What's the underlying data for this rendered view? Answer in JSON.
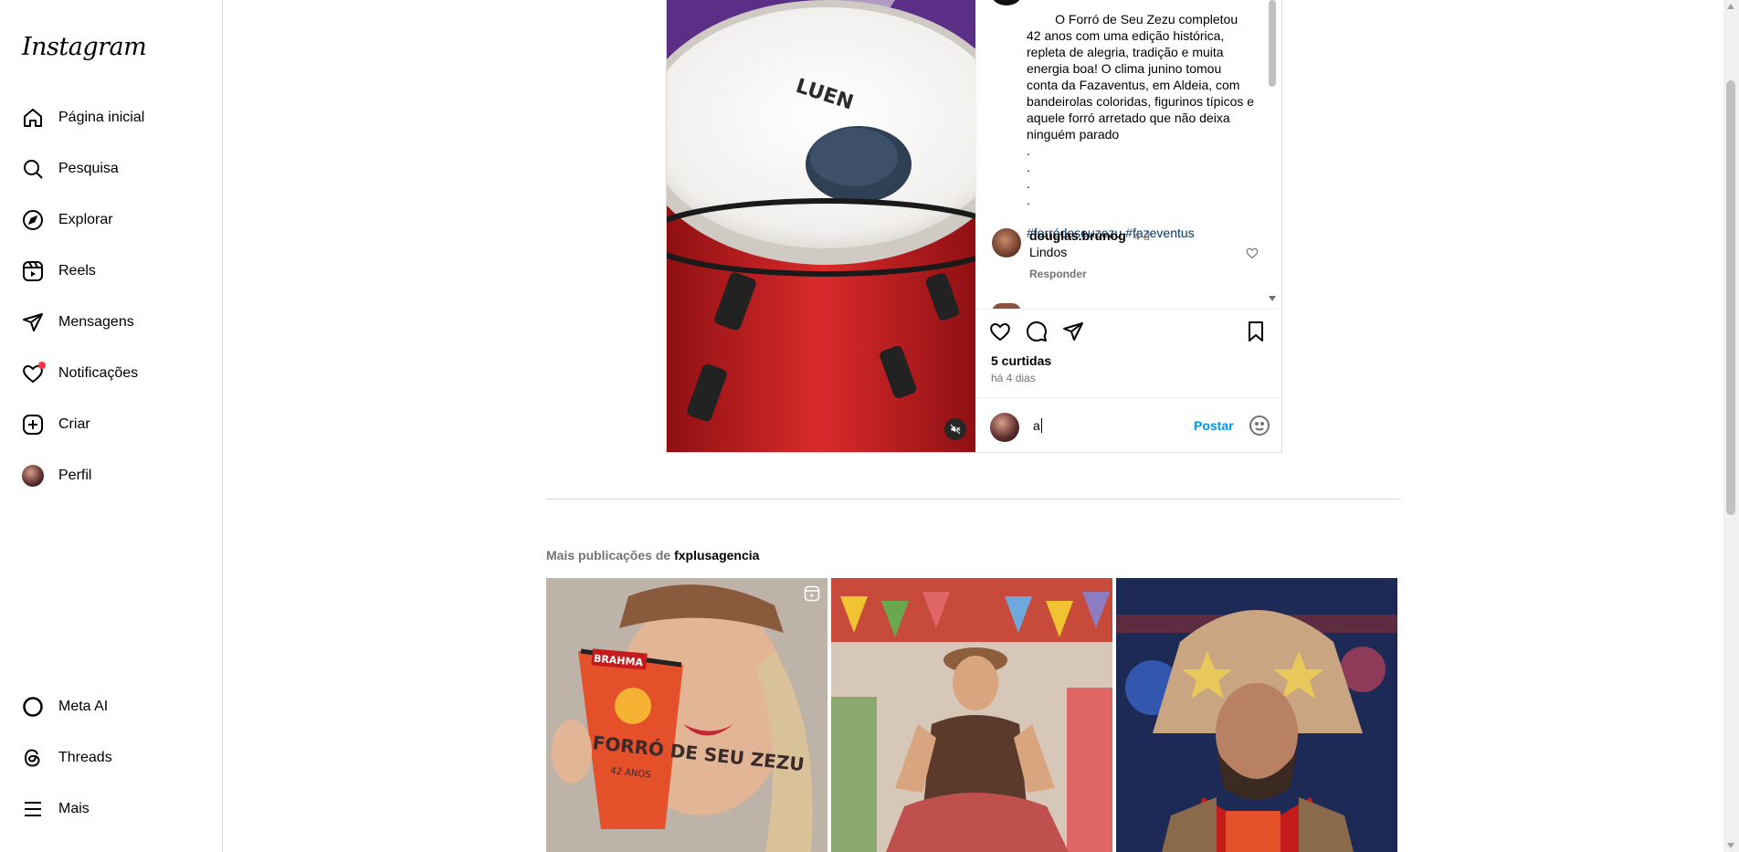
{
  "app": {
    "logo": "Instagram"
  },
  "nav": {
    "items": [
      {
        "key": "home",
        "label": "Página inicial"
      },
      {
        "key": "search",
        "label": "Pesquisa"
      },
      {
        "key": "explore",
        "label": "Explorar"
      },
      {
        "key": "reels",
        "label": "Reels"
      },
      {
        "key": "messages",
        "label": "Mensagens"
      },
      {
        "key": "notifications",
        "label": "Notificações"
      },
      {
        "key": "create",
        "label": "Criar"
      },
      {
        "key": "profile",
        "label": "Perfil"
      }
    ],
    "bottom": [
      {
        "key": "meta-ai",
        "label": "Meta AI"
      },
      {
        "key": "threads",
        "label": "Threads"
      },
      {
        "key": "more",
        "label": "Mais"
      }
    ]
  },
  "post": {
    "caption": "O Forró de Seu Zezu completou 42 anos com uma edição histórica, repleta de alegria, tradição e muita energia boa! O clima junino tomou conta da Fazaventus, em Aldeia, com bandeirolas coloridas, figurinos típicos e aquele forró arretado que não deixa ninguém parado\n.\n.\n.\n.",
    "hashtags": "#forródeseuzezu #fazeventus",
    "drum_brand": "LUEN",
    "comments": [
      {
        "user": "douglas.brunog",
        "time": "4 d",
        "text": "Lindos",
        "reply_label": "Responder"
      }
    ],
    "likes": "5 curtidas",
    "date": "há 4 dias",
    "comment_input": {
      "value": "a",
      "post_label": "Postar"
    }
  },
  "more": {
    "prefix": "Mais publicações de",
    "account": "fxplusagencia",
    "thumbs": [
      {
        "label": "BRAHMA",
        "cup_text": "FORRÓ DE SEU ZEZU",
        "cup_sub": "42 ANOS"
      },
      {
        "label": ""
      },
      {
        "label": ""
      }
    ]
  },
  "colors": {
    "accent": "#0095f6",
    "link": "#00376b",
    "notification_dot": "#ff3040"
  }
}
